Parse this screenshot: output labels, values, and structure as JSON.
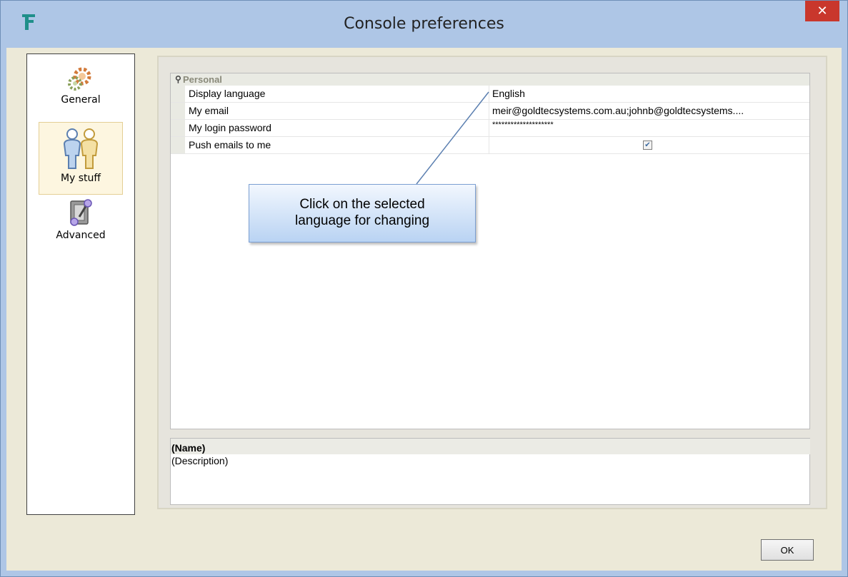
{
  "window": {
    "title": "Console preferences",
    "close_label": "✕"
  },
  "nav": {
    "items": [
      {
        "label": "General",
        "icon": "gear-icon"
      },
      {
        "label": "My stuff",
        "icon": "users-icon",
        "selected": true
      },
      {
        "label": "Advanced",
        "icon": "switch-icon"
      }
    ]
  },
  "properties": {
    "category": "Personal",
    "rows": [
      {
        "name": "Display language",
        "value": "English"
      },
      {
        "name": "My email",
        "value": "meir@goldtecsystems.com.au;johnb@goldtecsystems...."
      },
      {
        "name": "My login password",
        "value": "********************"
      },
      {
        "name": "Push emails to me",
        "value": "",
        "checked": true
      }
    ]
  },
  "callout": {
    "line1": "Click on the selected",
    "line2": "language for changing"
  },
  "description": {
    "name": "(Name)",
    "text": "(Description)"
  },
  "buttons": {
    "ok_label": "OK"
  },
  "colors": {
    "frame": "#aec6e6",
    "client": "#ece9d8",
    "close": "#c9372c",
    "callout_top": "#f2f7fe",
    "callout_bottom": "#b9d3f3"
  }
}
